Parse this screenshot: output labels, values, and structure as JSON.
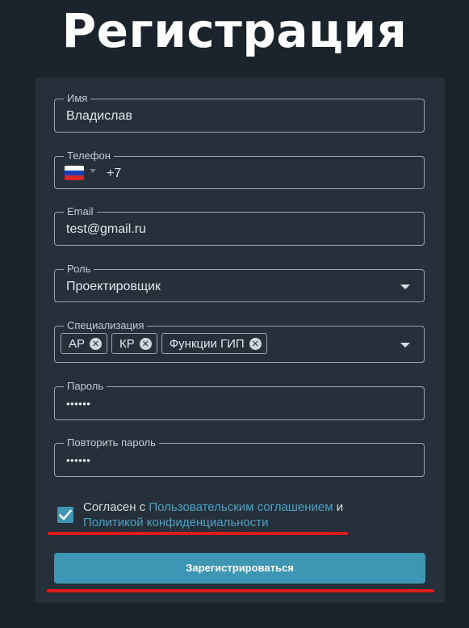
{
  "page": {
    "title": "Регистрация"
  },
  "form": {
    "name": {
      "label": "Имя",
      "value": "Владислав"
    },
    "phone": {
      "label": "Телефон",
      "country_flag": "russia-flag-icon",
      "value": "+7"
    },
    "email": {
      "label": "Email",
      "value": "test@gmail.ru"
    },
    "role": {
      "label": "Роль",
      "value": "Проектировщик"
    },
    "specialization": {
      "label": "Специализация",
      "chips": [
        "АР",
        "КР",
        "Функции ГИП"
      ]
    },
    "password": {
      "label": "Пароль",
      "value": "••••••"
    },
    "password_repeat": {
      "label": "Повторить пароль",
      "value": "••••••"
    },
    "agreement": {
      "checked": true,
      "prefix": "Согласен с ",
      "link1": "Пользовательским соглашением",
      "middle": " и ",
      "link2": "Политикой конфиденциальности"
    },
    "submit_label": "Зарегистрироваться"
  },
  "colors": {
    "background": "#1b232c",
    "card": "#25303b",
    "accent": "#3d96b4",
    "link": "#4aa3c2",
    "annotation_red": "#e01b1b"
  }
}
